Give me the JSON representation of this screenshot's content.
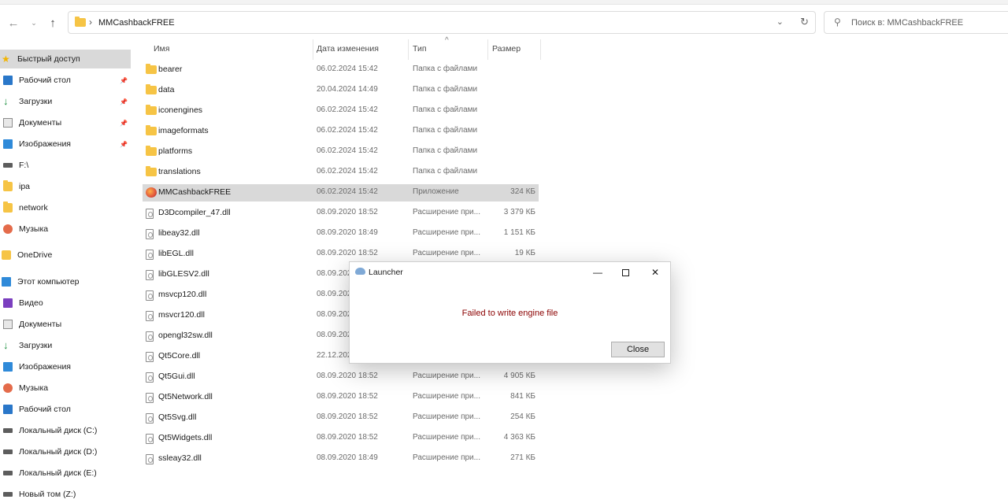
{
  "nav": {
    "back_icon": "arrow-left-icon",
    "forward_icon": "arrow-right-icon",
    "up_icon": "arrow-up-icon",
    "path": "MMCashbackFREE",
    "search_placeholder": "Поиск в: MMCashbackFREE"
  },
  "sidebar": {
    "items": [
      {
        "label": "Быстрый доступ",
        "icon": "star-icon",
        "active": true,
        "pinned": false
      },
      {
        "label": "Рабочий стол",
        "icon": "desktop-icon",
        "active": false,
        "pinned": true
      },
      {
        "label": "Загрузки",
        "icon": "download-icon",
        "active": false,
        "pinned": true
      },
      {
        "label": "Документы",
        "icon": "documents-icon",
        "active": false,
        "pinned": true
      },
      {
        "label": "Изображения",
        "icon": "pictures-icon",
        "active": false,
        "pinned": true
      },
      {
        "label": "F:\\",
        "icon": "drive-icon",
        "active": false,
        "pinned": false
      },
      {
        "label": "ipa",
        "icon": "folder-icon",
        "active": false,
        "pinned": false
      },
      {
        "label": "network",
        "icon": "folder-icon",
        "active": false,
        "pinned": false
      },
      {
        "label": "Музыка",
        "icon": "music-icon",
        "active": false,
        "pinned": false
      },
      {
        "label": "OneDrive",
        "icon": "onedrive-icon",
        "active": false,
        "pinned": false
      },
      {
        "label": "Этот компьютер",
        "icon": "computer-icon",
        "active": false,
        "pinned": false
      },
      {
        "label": "Видео",
        "icon": "video-icon",
        "active": false,
        "pinned": false
      },
      {
        "label": "Документы",
        "icon": "documents-icon",
        "active": false,
        "pinned": false
      },
      {
        "label": "Загрузки",
        "icon": "download-icon",
        "active": false,
        "pinned": false
      },
      {
        "label": "Изображения",
        "icon": "pictures-icon",
        "active": false,
        "pinned": false
      },
      {
        "label": "Музыка",
        "icon": "music-icon",
        "active": false,
        "pinned": false
      },
      {
        "label": "Рабочий стол",
        "icon": "desktop-icon",
        "active": false,
        "pinned": false
      },
      {
        "label": "Локальный диск (C:)",
        "icon": "drive-icon",
        "active": false,
        "pinned": false
      },
      {
        "label": "Локальный диск (D:)",
        "icon": "drive-icon",
        "active": false,
        "pinned": false
      },
      {
        "label": "Локальный диск (E:)",
        "icon": "drive-icon",
        "active": false,
        "pinned": false
      },
      {
        "label": "Новый том (Z:)",
        "icon": "drive-icon",
        "active": false,
        "pinned": false
      }
    ]
  },
  "columns": {
    "name": "Имя",
    "date": "Дата изменения",
    "type": "Тип",
    "size": "Размер"
  },
  "files": [
    {
      "name": "bearer",
      "date": "06.02.2024 15:42",
      "type": "Папка с файлами",
      "size": "",
      "kind": "folder"
    },
    {
      "name": "data",
      "date": "20.04.2024 14:49",
      "type": "Папка с файлами",
      "size": "",
      "kind": "folder"
    },
    {
      "name": "iconengines",
      "date": "06.02.2024 15:42",
      "type": "Папка с файлами",
      "size": "",
      "kind": "folder"
    },
    {
      "name": "imageformats",
      "date": "06.02.2024 15:42",
      "type": "Папка с файлами",
      "size": "",
      "kind": "folder"
    },
    {
      "name": "platforms",
      "date": "06.02.2024 15:42",
      "type": "Папка с файлами",
      "size": "",
      "kind": "folder"
    },
    {
      "name": "translations",
      "date": "06.02.2024 15:42",
      "type": "Папка с файлами",
      "size": "",
      "kind": "folder"
    },
    {
      "name": "MMCashbackFREE",
      "date": "06.02.2024 15:42",
      "type": "Приложение",
      "size": "324 КБ",
      "kind": "exe",
      "selected": true
    },
    {
      "name": "D3Dcompiler_47.dll",
      "date": "08.09.2020 18:52",
      "type": "Расширение при...",
      "size": "3 379 КБ",
      "kind": "dll"
    },
    {
      "name": "libeay32.dll",
      "date": "08.09.2020 18:49",
      "type": "Расширение при...",
      "size": "1 151 КБ",
      "kind": "dll"
    },
    {
      "name": "libEGL.dll",
      "date": "08.09.2020 18:52",
      "type": "Расширение при...",
      "size": "19 КБ",
      "kind": "dll"
    },
    {
      "name": "libGLESV2.dll",
      "date": "08.09.202",
      "type": "",
      "size": "",
      "kind": "dll"
    },
    {
      "name": "msvcp120.dll",
      "date": "08.09.202",
      "type": "",
      "size": "",
      "kind": "dll"
    },
    {
      "name": "msvcr120.dll",
      "date": "08.09.202",
      "type": "",
      "size": "",
      "kind": "dll"
    },
    {
      "name": "opengl32sw.dll",
      "date": "08.09.202",
      "type": "",
      "size": "",
      "kind": "dll"
    },
    {
      "name": "Qt5Core.dll",
      "date": "22.12.202",
      "type": "",
      "size": "",
      "kind": "dll"
    },
    {
      "name": "Qt5Gui.dll",
      "date": "08.09.2020 18:52",
      "type": "Расширение при...",
      "size": "4 905 КБ",
      "kind": "dll"
    },
    {
      "name": "Qt5Network.dll",
      "date": "08.09.2020 18:52",
      "type": "Расширение при...",
      "size": "841 КБ",
      "kind": "dll"
    },
    {
      "name": "Qt5Svg.dll",
      "date": "08.09.2020 18:52",
      "type": "Расширение при...",
      "size": "254 КБ",
      "kind": "dll"
    },
    {
      "name": "Qt5Widgets.dll",
      "date": "08.09.2020 18:52",
      "type": "Расширение при...",
      "size": "4 363 КБ",
      "kind": "dll"
    },
    {
      "name": "ssleay32.dll",
      "date": "08.09.2020 18:49",
      "type": "Расширение при...",
      "size": "271 КБ",
      "kind": "dll"
    }
  ],
  "dialog": {
    "title": "Launcher",
    "message": "Failed to write engine file",
    "close_button": "Close",
    "message_color": "#8b0000"
  }
}
